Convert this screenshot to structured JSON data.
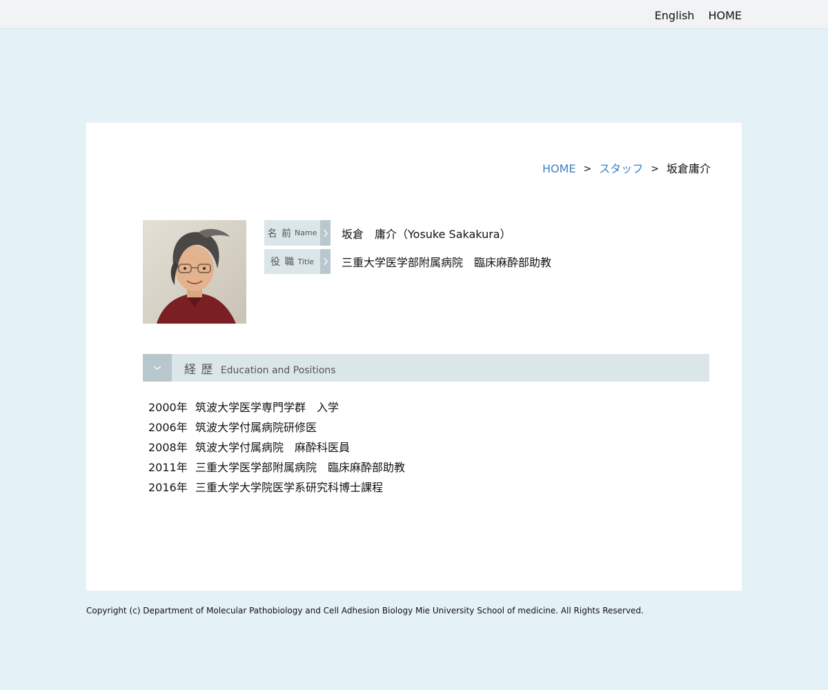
{
  "topnav": {
    "english": "English",
    "home": "HOME"
  },
  "breadcrumb": {
    "home": "HOME",
    "sep1": ">",
    "staff": "スタッフ",
    "sep2": ">",
    "current": "坂倉庸介"
  },
  "profile": {
    "name_label_ja": "名 前",
    "name_label_en": "Name",
    "name_value": "坂倉　庸介（Yosuke Sakakura）",
    "title_label_ja": "役 職",
    "title_label_en": "Title",
    "title_value": "三重大学医学部附属病院　臨床麻酔部助教",
    "arrow_icon": "chevron-right-icon"
  },
  "section": {
    "title_ja": "経 歴",
    "title_en": "Education and Positions",
    "toggle_icon": "chevron-down-icon"
  },
  "history": [
    {
      "year": "2000年",
      "text": "筑波大学医学専門学群　入学"
    },
    {
      "year": "2006年",
      "text": "筑波大学付属病院研修医"
    },
    {
      "year": "2008年",
      "text": "筑波大学付属病院　麻酔科医員"
    },
    {
      "year": "2011年",
      "text": "三重大学医学部附属病院　臨床麻酔部助教"
    },
    {
      "year": "2016年",
      "text": "三重大学大学院医学系研究科博士課程"
    }
  ],
  "footer": {
    "copyright": "Copyright (c) Department of Molecular Pathobiology and Cell Adhesion Biology Mie University School of medicine. All Rights Reserved."
  },
  "colors": {
    "page_bg": "#e4f1f6",
    "link": "#3b82c4",
    "label_bg": "#dbe6ea",
    "label_arrow_bg": "#b9c8ce"
  }
}
